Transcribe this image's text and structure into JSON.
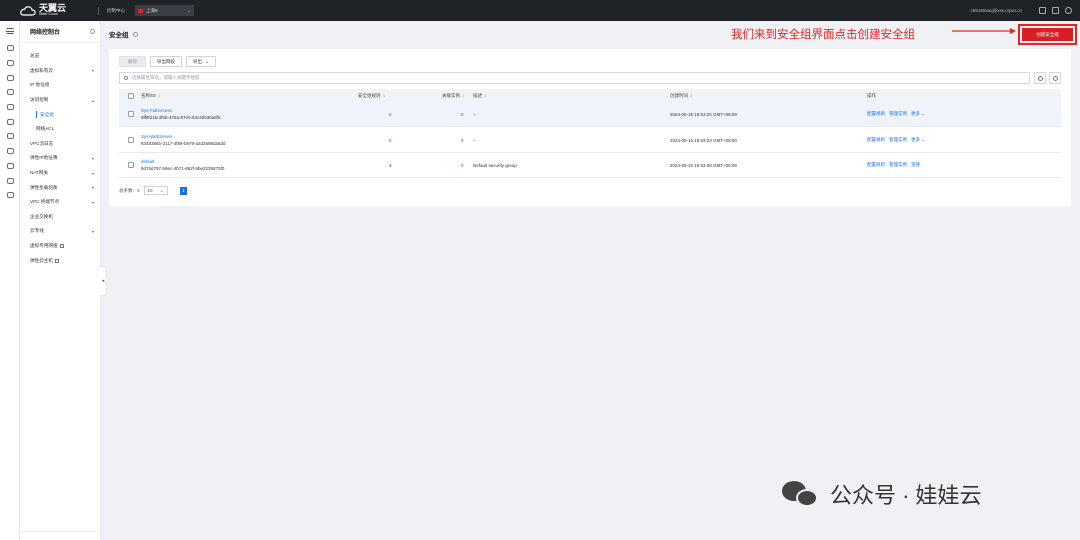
{
  "topbar": {
    "logo_cn": "天翼云",
    "logo_en": "State Cloud",
    "console": "控制中心",
    "region": "上海8",
    "user": "c65186xaq@xxx.ctyun.cn"
  },
  "sidebar": {
    "title": "网络控制台",
    "items": [
      {
        "label": "总览"
      },
      {
        "label": "虚拟私有云"
      },
      {
        "label": "IP 地址组"
      },
      {
        "label": "访问控制"
      },
      {
        "label": "安全组"
      },
      {
        "label": "网络ACL"
      },
      {
        "label": "VPC流日志"
      },
      {
        "label": "弹性IP地址簿"
      },
      {
        "label": "NAT网关"
      },
      {
        "label": "弹性负载均衡"
      },
      {
        "label": "VPC 终端节点"
      },
      {
        "label": "企业交换机"
      },
      {
        "label": "云专线"
      },
      {
        "label": "虚拟专用网络"
      },
      {
        "label": "弹性云主机"
      }
    ]
  },
  "page": {
    "title": "安全组",
    "annotation": "我们来到安全组界面点击创建安全组",
    "create_button": "创建安全组"
  },
  "toolbar": {
    "delete": "删除",
    "export_network": "导出网段",
    "export": "导出"
  },
  "search": {
    "placeholder": "选择属性筛选，或输入关键字搜索"
  },
  "table": {
    "headers": [
      "名称/ID",
      "安全组规则",
      "关联实例",
      "描述",
      "创建时间",
      "操作"
    ],
    "rows": [
      {
        "name": "Sys-FullAccess",
        "id": "9ff8f21b-4f5b-476a-87e0-53c40536a8f2",
        "rules": "6",
        "instances": "0",
        "desc": "--",
        "created": "2024-05-16 18:53:24 GMT+08:00",
        "ops": [
          "配置规则",
          "管理实例",
          "更多 ⌄"
        ]
      },
      {
        "name": "Sys-WebServer",
        "id": "8348386b-3117-4f89-b979-a2d2698da5dd",
        "rules": "6",
        "instances": "0",
        "desc": "--",
        "created": "2024-05-16 18:53:23 GMT+08:00",
        "ops": [
          "配置规则",
          "管理实例",
          "更多 ⌄"
        ]
      },
      {
        "name": "default",
        "id": "9d76d797-b8ec-4b71-862f-9be2235875f0",
        "rules": "4",
        "instances": "0",
        "desc": "Default security group",
        "created": "2024-05-16 18:53:08 GMT+08:00",
        "ops": [
          "配置规则",
          "管理实例",
          "克隆"
        ]
      }
    ]
  },
  "pagination": {
    "total": "总条数：3",
    "page_size": "10",
    "current": "1"
  },
  "watermark": "公众号 · 娃娃云",
  "colors": {
    "accent": "#1b6fe8",
    "danger": "#d91f25",
    "annotation": "#e8231f"
  }
}
